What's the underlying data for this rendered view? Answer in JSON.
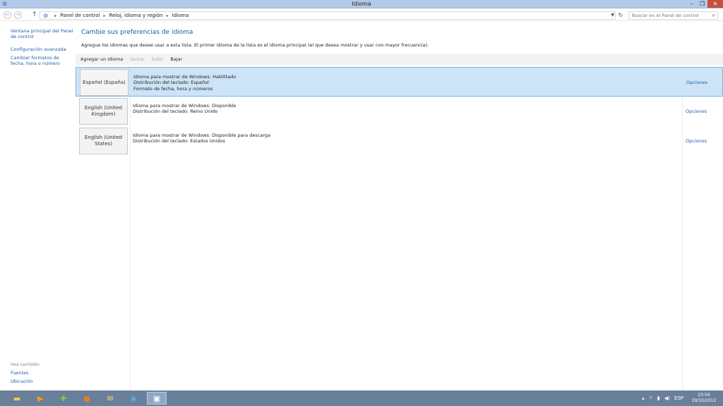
{
  "window": {
    "title": "Idioma"
  },
  "address": {
    "crumbs": [
      "Panel de control",
      "Reloj, idioma y región",
      "Idioma"
    ],
    "search_placeholder": "Buscar en el Panel de control"
  },
  "sidebar": {
    "links": [
      "Ventana principal del Panel de control",
      "Configuración avanzada",
      "Cambiar formatos de fecha, hora o número"
    ],
    "see_also": "Vea también",
    "see_also_links": [
      "Fuentes",
      "Ubicación"
    ]
  },
  "main": {
    "title": "Cambie sus preferencias de idioma",
    "intro": "Agregue los idiomas que desee usar a esta lista. El primer idioma de la lista es el idioma principal (el que desea mostrar y usar con mayor frecuencia).",
    "toolbar": {
      "add": "Agregar un idioma",
      "remove": "Quitar",
      "up": "Subir",
      "down": "Bajar"
    },
    "languages": [
      {
        "name": "Español (España)",
        "lines": [
          "Idioma para mostrar de Windows: Habilitado",
          "Distribución del teclado: Español",
          "Formato de fecha, hora y números"
        ],
        "options": "Opciones"
      },
      {
        "name": "English (United Kingdom)",
        "lines": [
          "Idioma para mostrar de Windows: Disponible",
          "Distribución del teclado: Reino Unido"
        ],
        "options": "Opciones"
      },
      {
        "name": "English (United States)",
        "lines": [
          "Idioma para mostrar de Windows: Disponible para descarga",
          "Distribución del teclado: Estados Unidos"
        ],
        "options": "Opciones"
      }
    ]
  },
  "taskbar": {
    "language": "ESP",
    "time": "23:56",
    "date": "29/10/2012"
  },
  "colors": {
    "accent": "#1e5aa0",
    "selection": "#cde4f7",
    "taskbar": "#6a7f99"
  }
}
